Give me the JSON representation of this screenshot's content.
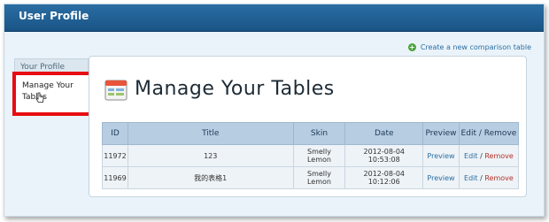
{
  "header": {
    "title": "User Profile"
  },
  "create_link": {
    "label": "Create a new comparison table",
    "icon": "plus-circle-icon"
  },
  "sidebar": {
    "items": [
      {
        "label": "Your Profile"
      },
      {
        "label": "Manage Your Tables",
        "active": true
      }
    ]
  },
  "main": {
    "title": "Manage Your Tables",
    "table": {
      "headers": [
        "ID",
        "Title",
        "Skin",
        "Date",
        "Preview",
        "Edit",
        "/",
        "Remove"
      ],
      "rows": [
        {
          "id": "11972",
          "title": "123",
          "skin": "Smelly Lemon",
          "date": "2012-08-04 10:53:08",
          "preview": "Preview",
          "edit": "Edit",
          "sep": "/",
          "remove": "Remove"
        },
        {
          "id": "11969",
          "title": "我的表格1",
          "skin": "Smelly Lemon",
          "date": "2012-08-04 10:12:06",
          "preview": "Preview",
          "edit": "Edit",
          "sep": "/",
          "remove": "Remove"
        }
      ]
    }
  },
  "colors": {
    "highlight": "#e60d12",
    "header_bar": "#1a5486",
    "link": "#2a6ea3",
    "remove": "#b3302a"
  }
}
